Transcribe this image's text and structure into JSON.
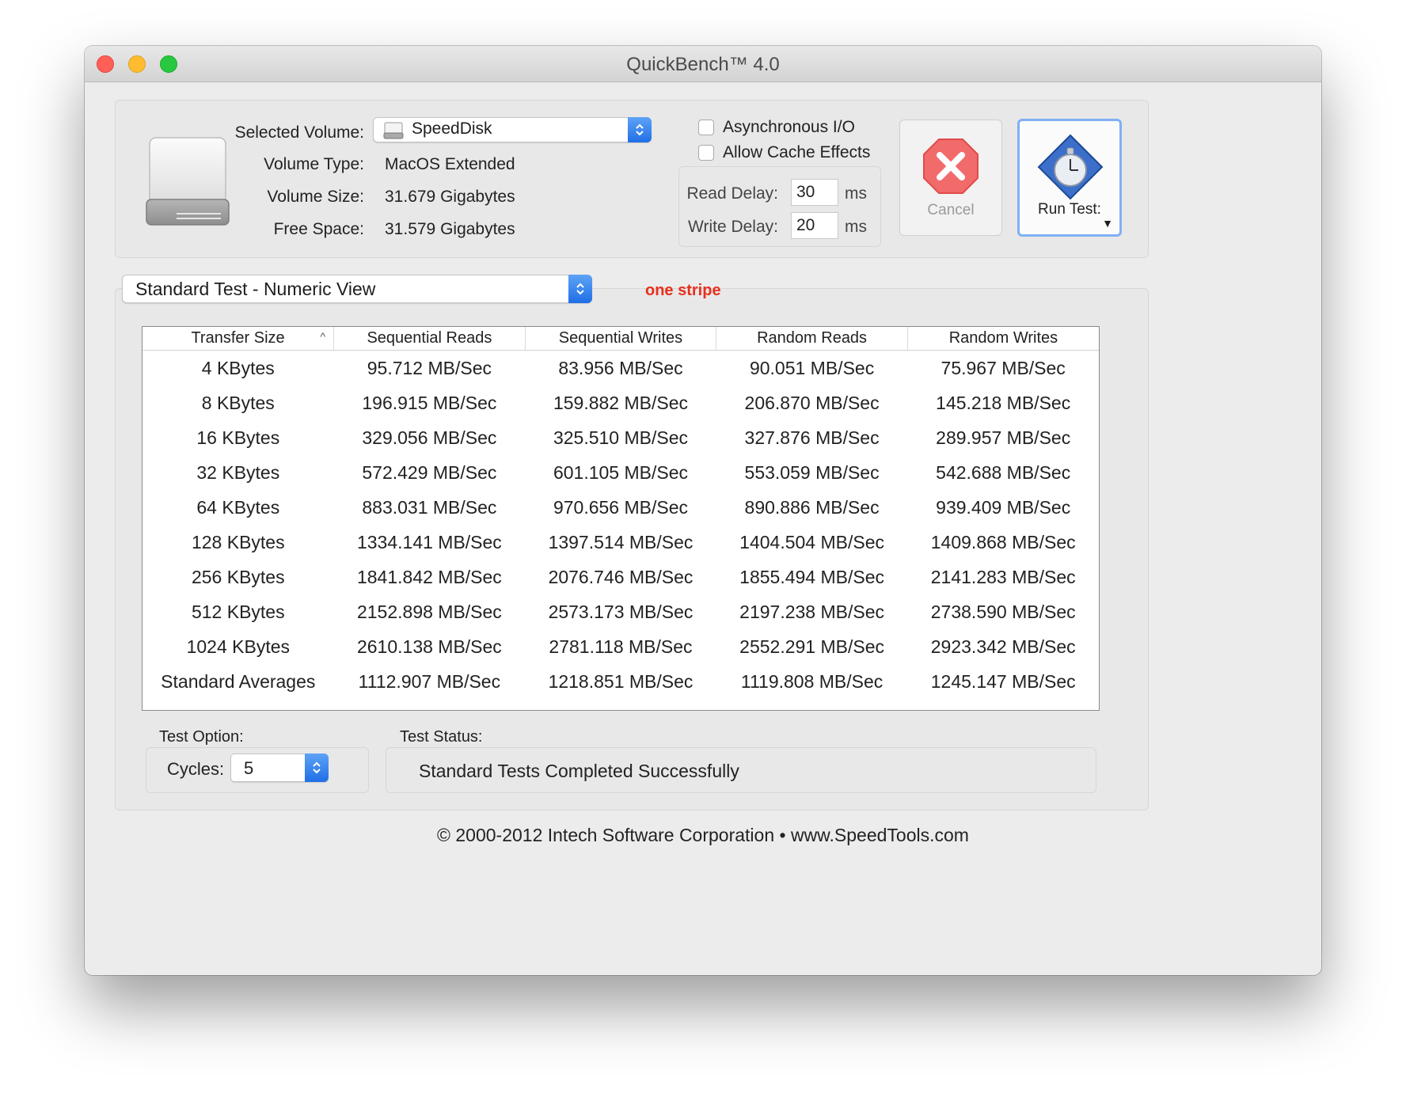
{
  "window": {
    "title": "QuickBench™ 4.0"
  },
  "volume": {
    "selected_label": "Selected Volume:",
    "selected_value": "SpeedDisk",
    "type_label": "Volume Type:",
    "type_value": "MacOS Extended",
    "size_label": "Volume Size:",
    "size_value": "31.679 Gigabytes",
    "free_label": "Free Space:",
    "free_value": "31.579 Gigabytes"
  },
  "options": {
    "async_io_label": "Asynchronous I/O",
    "async_io_checked": false,
    "cache_label": "Allow Cache Effects",
    "cache_checked": false,
    "read_delay_label": "Read Delay:",
    "read_delay_value": "30",
    "write_delay_label": "Write Delay:",
    "write_delay_value": "20",
    "unit": "ms"
  },
  "buttons": {
    "cancel_label": "Cancel",
    "run_label": "Run Test:"
  },
  "view_select": {
    "value": "Standard Test - Numeric View"
  },
  "annotation": "one stripe",
  "table": {
    "headers": [
      "Transfer Size",
      "Sequential Reads",
      "Sequential Writes",
      "Random Reads",
      "Random Writes"
    ],
    "rows": [
      [
        "4 KBytes",
        "95.712 MB/Sec",
        "83.956 MB/Sec",
        "90.051 MB/Sec",
        "75.967 MB/Sec"
      ],
      [
        "8 KBytes",
        "196.915 MB/Sec",
        "159.882 MB/Sec",
        "206.870 MB/Sec",
        "145.218 MB/Sec"
      ],
      [
        "16 KBytes",
        "329.056 MB/Sec",
        "325.510 MB/Sec",
        "327.876 MB/Sec",
        "289.957 MB/Sec"
      ],
      [
        "32 KBytes",
        "572.429 MB/Sec",
        "601.105 MB/Sec",
        "553.059 MB/Sec",
        "542.688 MB/Sec"
      ],
      [
        "64 KBytes",
        "883.031 MB/Sec",
        "970.656 MB/Sec",
        "890.886 MB/Sec",
        "939.409 MB/Sec"
      ],
      [
        "128 KBytes",
        "1334.141 MB/Sec",
        "1397.514 MB/Sec",
        "1404.504 MB/Sec",
        "1409.868 MB/Sec"
      ],
      [
        "256 KBytes",
        "1841.842 MB/Sec",
        "2076.746 MB/Sec",
        "1855.494 MB/Sec",
        "2141.283 MB/Sec"
      ],
      [
        "512 KBytes",
        "2152.898 MB/Sec",
        "2573.173 MB/Sec",
        "2197.238 MB/Sec",
        "2738.590 MB/Sec"
      ],
      [
        "1024 KBytes",
        "2610.138 MB/Sec",
        "2781.118 MB/Sec",
        "2552.291 MB/Sec",
        "2923.342 MB/Sec"
      ],
      [
        "Standard Averages",
        "1112.907 MB/Sec",
        "1218.851 MB/Sec",
        "1119.808 MB/Sec",
        "1245.147 MB/Sec"
      ]
    ]
  },
  "test_option": {
    "label": "Test Option:",
    "cycles_label": "Cycles:",
    "cycles_value": "5"
  },
  "test_status": {
    "label": "Test Status:",
    "message": "Standard Tests Completed Successfully"
  },
  "footer": "© 2000-2012 Intech Software Corporation • www.SpeedTools.com",
  "colors": {
    "accent_blue": "#1f6fe5",
    "annotation_red": "#e8301c"
  }
}
